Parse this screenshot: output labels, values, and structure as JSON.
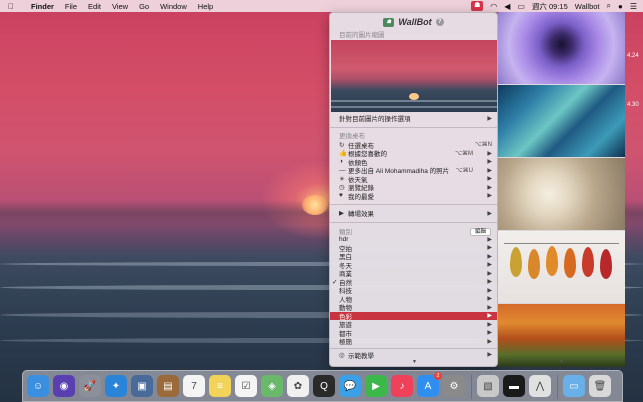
{
  "menubar": {
    "app_name": "Finder",
    "items": [
      "File",
      "Edit",
      "View",
      "Go",
      "Window",
      "Help"
    ],
    "datetime": "週六 09:15",
    "app_label": "Wallbot"
  },
  "popup": {
    "title": "WallBot",
    "current_label": "目前的圖片縮圖",
    "current_actions": "針對目前圖片的操作選項",
    "change_label": "更換桌布",
    "change_items": [
      {
        "icon": "refresh-icon",
        "glyph": "↻",
        "label": "任選桌布",
        "shortcut": "⌥⌘N",
        "arrow": false
      },
      {
        "icon": "thumbs-up-icon",
        "glyph": "👍",
        "label": "根據您喜歡的",
        "shortcut": "⌥⌘M",
        "arrow": true
      },
      {
        "icon": "contrast-icon",
        "glyph": "◑",
        "label": "依顏色",
        "shortcut": "",
        "arrow": true
      },
      {
        "icon": "dash-icon",
        "glyph": "—",
        "label": "更多出自 Ali Mohammadiha 的照片",
        "shortcut": "⌥⌘U",
        "arrow": true
      },
      {
        "icon": "sun-icon",
        "glyph": "☀",
        "label": "依天氣",
        "shortcut": "",
        "arrow": true
      },
      {
        "icon": "history-icon",
        "glyph": "◷",
        "label": "瀏覽紀錄",
        "shortcut": "",
        "arrow": true
      },
      {
        "icon": "heart-icon",
        "glyph": "♥",
        "label": "我的最愛",
        "shortcut": "",
        "arrow": true
      }
    ],
    "transition_label": "轉場效果",
    "category_label": "類別",
    "edit_label": "編輯",
    "categories": [
      {
        "label": "hdr",
        "checked": false,
        "highlighted": false
      },
      {
        "label": "空拍",
        "checked": false,
        "highlighted": false
      },
      {
        "label": "黑白",
        "checked": false,
        "highlighted": false
      },
      {
        "label": "冬天",
        "checked": false,
        "highlighted": false
      },
      {
        "label": "商業",
        "checked": false,
        "highlighted": false
      },
      {
        "label": "自然",
        "checked": true,
        "highlighted": false
      },
      {
        "label": "科技",
        "checked": false,
        "highlighted": false
      },
      {
        "label": "人物",
        "checked": false,
        "highlighted": false
      },
      {
        "label": "動物",
        "checked": false,
        "highlighted": false
      },
      {
        "label": "色彩",
        "checked": false,
        "highlighted": true
      },
      {
        "label": "旅遊",
        "checked": false,
        "highlighted": false
      },
      {
        "label": "都市",
        "checked": false,
        "highlighted": false
      },
      {
        "label": "極簡",
        "checked": false,
        "highlighted": false
      }
    ],
    "more_label": "示範教學"
  },
  "side_numbers": [
    "4.24",
    "4.30"
  ],
  "dock": [
    {
      "icon": "finder-icon",
      "color": "#3b8fe0"
    },
    {
      "icon": "siri-icon",
      "color": "#5a3fb0"
    },
    {
      "icon": "launchpad-icon",
      "color": "#8a8f99"
    },
    {
      "icon": "safari-icon",
      "color": "#2a84d8"
    },
    {
      "icon": "preview-icon",
      "color": "#4a6a9a"
    },
    {
      "icon": "notes-book-icon",
      "color": "#9a6a3a"
    },
    {
      "icon": "calendar-icon",
      "color": "#f4f4f4",
      "text": "7"
    },
    {
      "icon": "notes-icon",
      "color": "#f2d35a"
    },
    {
      "icon": "reminders-icon",
      "color": "#f4f4f4"
    },
    {
      "icon": "maps-icon",
      "color": "#6ab86a"
    },
    {
      "icon": "photos-icon",
      "color": "#f0f0f0"
    },
    {
      "icon": "quicktime-icon",
      "color": "#2a2a2a"
    },
    {
      "icon": "messages-icon",
      "color": "#3aa0e8"
    },
    {
      "icon": "facetime-icon",
      "color": "#3cb84a"
    },
    {
      "icon": "music-icon",
      "color": "#f0415a"
    },
    {
      "icon": "appstore-icon",
      "color": "#2f8ff0",
      "badge": "2"
    },
    {
      "icon": "settings-icon",
      "color": "#8a8a8a"
    },
    {
      "icon": "photo-frame-icon",
      "color": "#c8c8c8"
    },
    {
      "icon": "monitor-icon",
      "color": "#1a1a1a"
    },
    {
      "icon": "wallbot-dock-icon",
      "color": "#e0e0e0"
    },
    {
      "icon": "folder-icon",
      "color": "#6ab0e8"
    },
    {
      "icon": "trash-icon",
      "color": "#d8d8d8"
    }
  ]
}
